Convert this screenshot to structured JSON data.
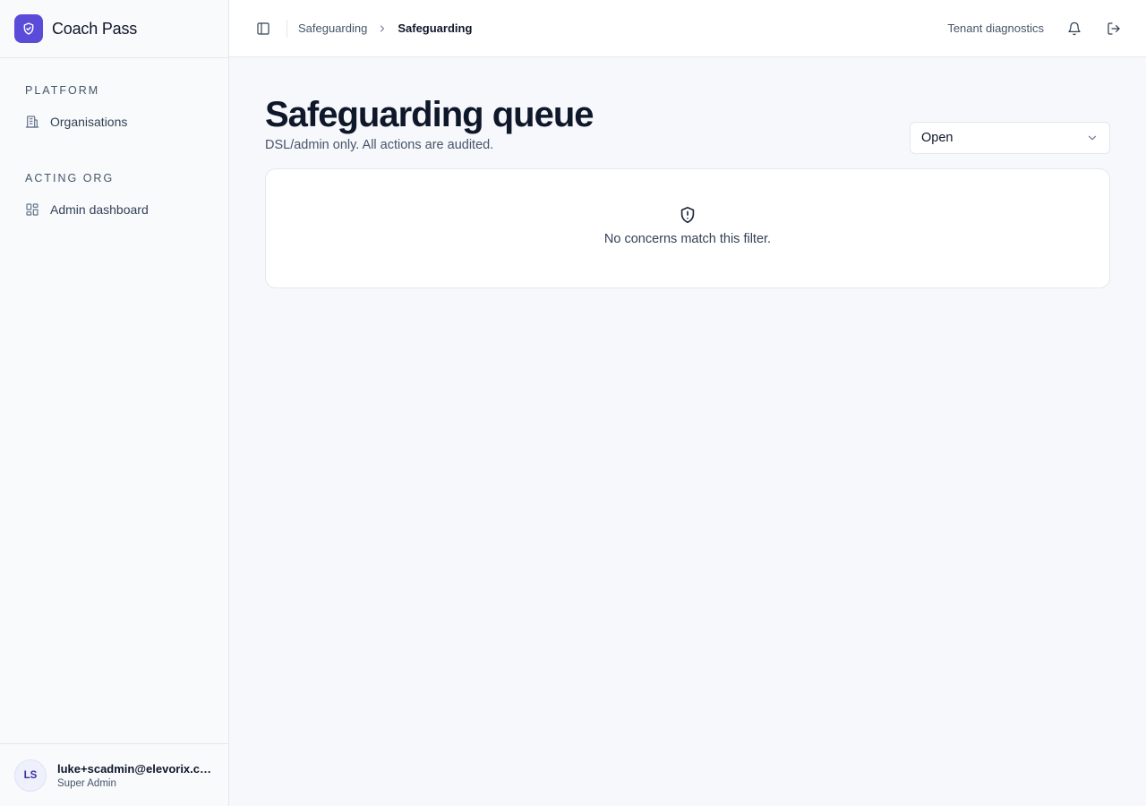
{
  "brand": {
    "name": "Coach Pass"
  },
  "sidebar": {
    "sections": [
      {
        "heading": "Platform",
        "items": [
          {
            "label": "Organisations",
            "icon": "building-icon"
          }
        ]
      },
      {
        "heading": "Acting org",
        "items": [
          {
            "label": "Admin dashboard",
            "icon": "dashboard-icon"
          }
        ]
      }
    ],
    "user": {
      "initials": "LS",
      "email": "luke+scadmin@elevorix.co.uk",
      "role": "Super Admin"
    }
  },
  "topbar": {
    "breadcrumb": [
      "Safeguarding",
      "Safeguarding"
    ],
    "tenant_link": "Tenant diagnostics",
    "icons": [
      "sidebar-toggle-icon",
      "bell-icon",
      "logout-icon"
    ]
  },
  "main": {
    "title": "Safeguarding queue",
    "subtitle": "DSL/admin only. All actions are audited.",
    "filter": {
      "selected": "Open"
    },
    "empty_state": {
      "icon": "shield-alert-icon",
      "message": "No concerns match this filter."
    }
  },
  "colors": {
    "brand": "#5b4bd9",
    "text": "#0f172a",
    "muted": "#475569",
    "border": "#e2e8f0"
  }
}
